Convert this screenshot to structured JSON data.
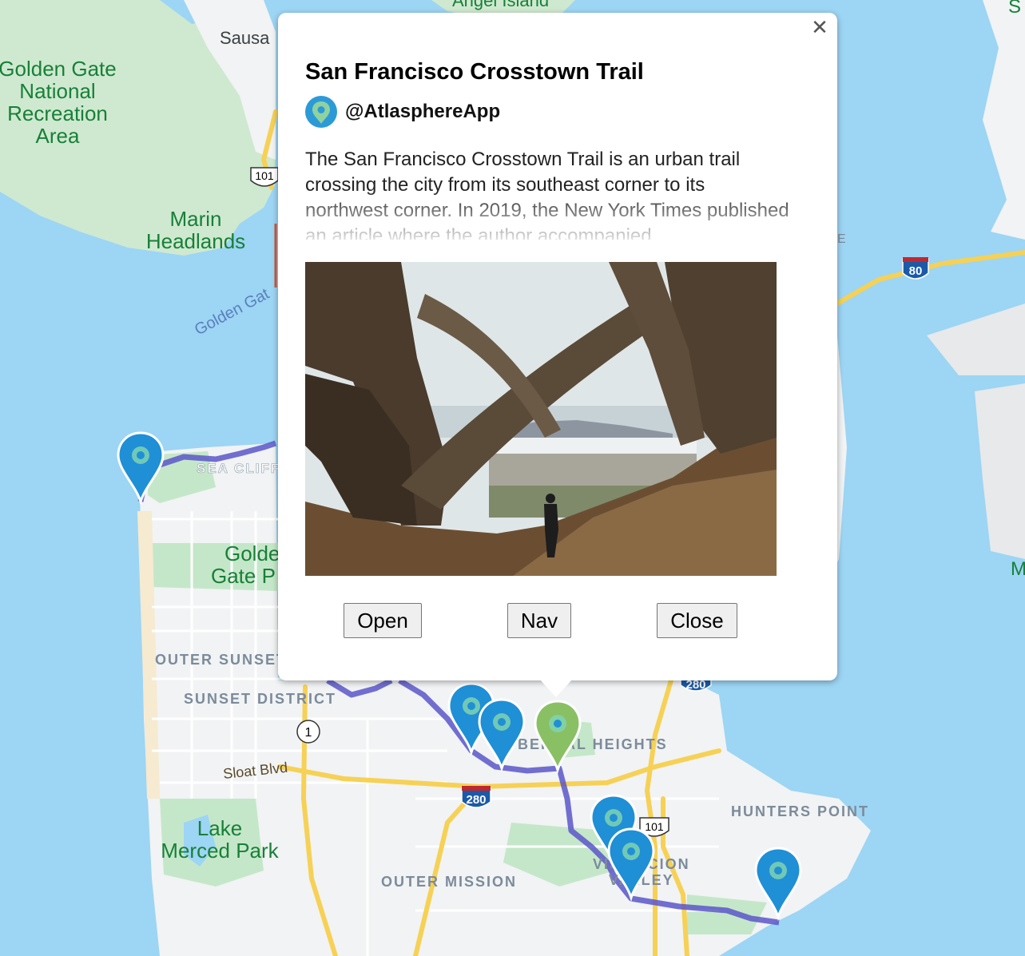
{
  "map": {
    "colors": {
      "water": "#9dd5f4",
      "land": "#f1f3f4",
      "park": "#c5e7c9",
      "route": "#5a56c9",
      "highway": "#f6d155",
      "pin_blue": "#1f8fd6",
      "pin_green": "#8ac064"
    },
    "labels": {
      "angel_island": "Angel Island",
      "sausalito": "Sausa",
      "ggnra_1": "Golden Gate",
      "ggnra_2": "National",
      "ggnra_3": "Recreation",
      "ggnra_4": "Area",
      "marin_1": "Marin",
      "marin_2": "Headlands",
      "golden_gate_strait": "Golden Gat",
      "sea_cliff": "SEA CLIFF",
      "ggpark_1": "Golde",
      "ggpark_2": "Gate P",
      "outer_sunset": "OUTER SUNSET",
      "sunset_district": "SUNSET DISTRICT",
      "sloat": "Sloat Blvd",
      "lake_merced_1": "Lake",
      "lake_merced_2": "Merced Park",
      "outer_mission": "OUTER MISSION",
      "bernal": "BERNAL HEIGHTS",
      "visitacion_1": "VISITACION",
      "visitacion_2": "VALLEY",
      "hunters_point": "HUNTERS POINT",
      "edge_s": "S",
      "edge_m": "M",
      "edge_e": "E"
    },
    "shields": {
      "us101_north": "101",
      "i80": "80",
      "ca1": "1",
      "i280_south": "280",
      "i280_east": "280",
      "us101_south": "101"
    }
  },
  "popup": {
    "title": "San Francisco Crosstown Trail",
    "author": "@AtlasphereApp",
    "close_icon": "close-icon",
    "description": "The San Francisco Crosstown Trail is an urban trail crossing the city from its southeast corner to its northwest corner. In 2019, the New York Times published an article where the author accompanied",
    "buttons": {
      "open": "Open",
      "nav": "Nav",
      "close": "Close"
    }
  }
}
